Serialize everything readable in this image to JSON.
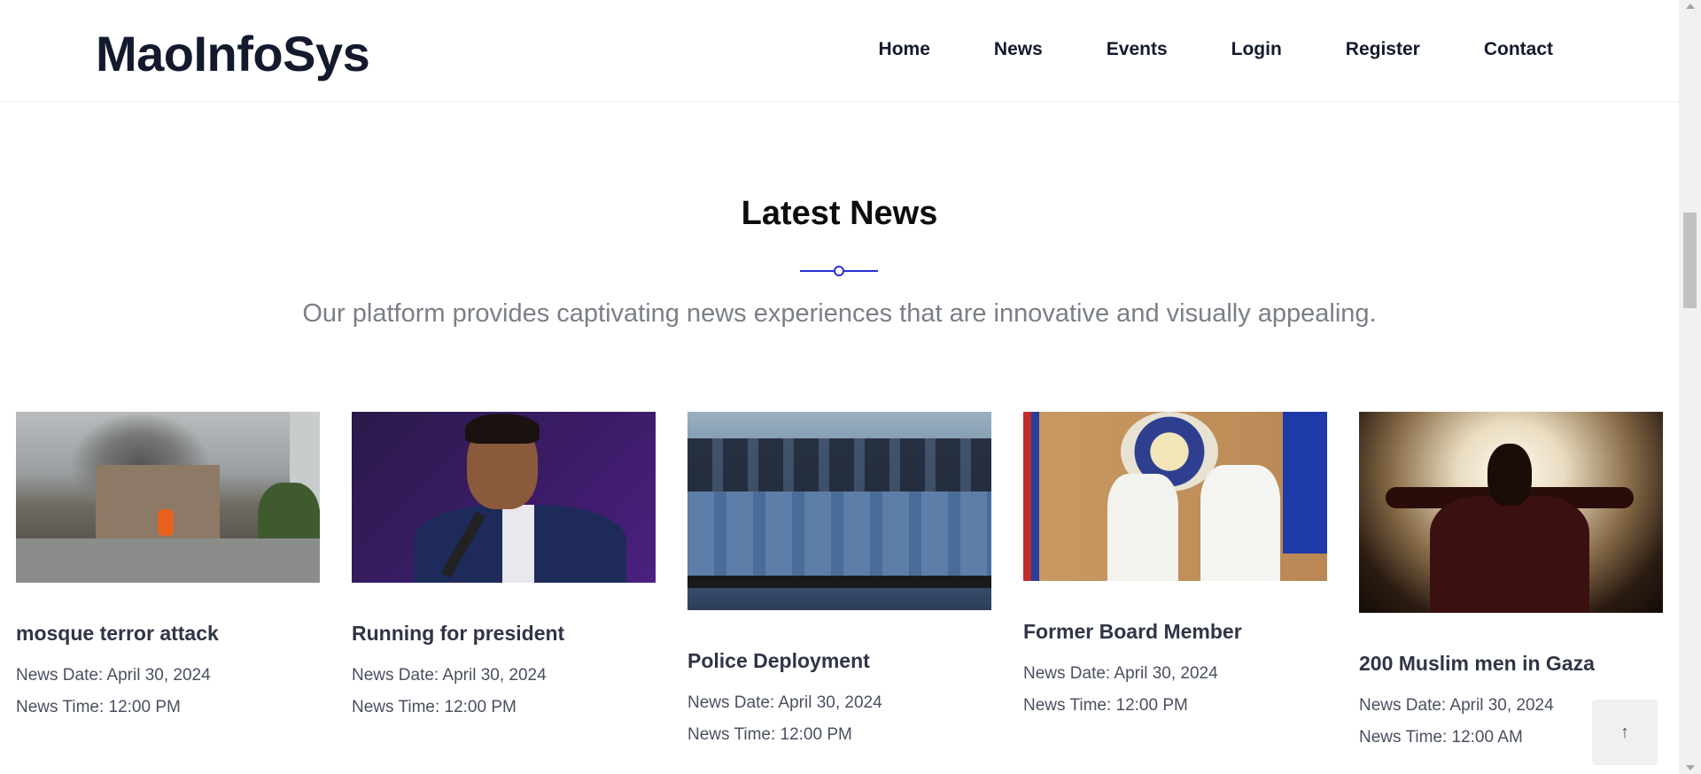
{
  "brand": {
    "name": "MaoInfoSys"
  },
  "nav": {
    "items": [
      {
        "label": "Home"
      },
      {
        "label": "News"
      },
      {
        "label": "Events"
      },
      {
        "label": "Login"
      },
      {
        "label": "Register"
      },
      {
        "label": "Contact"
      }
    ]
  },
  "section": {
    "title": "Latest News",
    "subtitle": "Our platform provides captivating news experiences that are innovative and visually appealing."
  },
  "news": [
    {
      "title": "mosque terror attack",
      "date": "News Date: April 30, 2024",
      "time": "News Time: 12:00 PM"
    },
    {
      "title": "Running for president",
      "date": "News Date: April 30, 2024",
      "time": "News Time: 12:00 PM"
    },
    {
      "title": "Police Deployment",
      "date": "News Date: April 30, 2024",
      "time": "News Time: 12:00 PM"
    },
    {
      "title": "Former Board Member",
      "date": "News Date: April 30, 2024",
      "time": "News Time: 12:00 PM"
    },
    {
      "title": "200 Muslim men in Gaza",
      "date": "News Date: April 30, 2024",
      "time": "News Time: 12:00 AM"
    }
  ],
  "back_to_top": {
    "icon": "arrow-up-icon",
    "glyph": "↑"
  },
  "colors": {
    "accent": "#2b2fd6",
    "heading": "#131a2e",
    "muted": "#7a7f87"
  }
}
